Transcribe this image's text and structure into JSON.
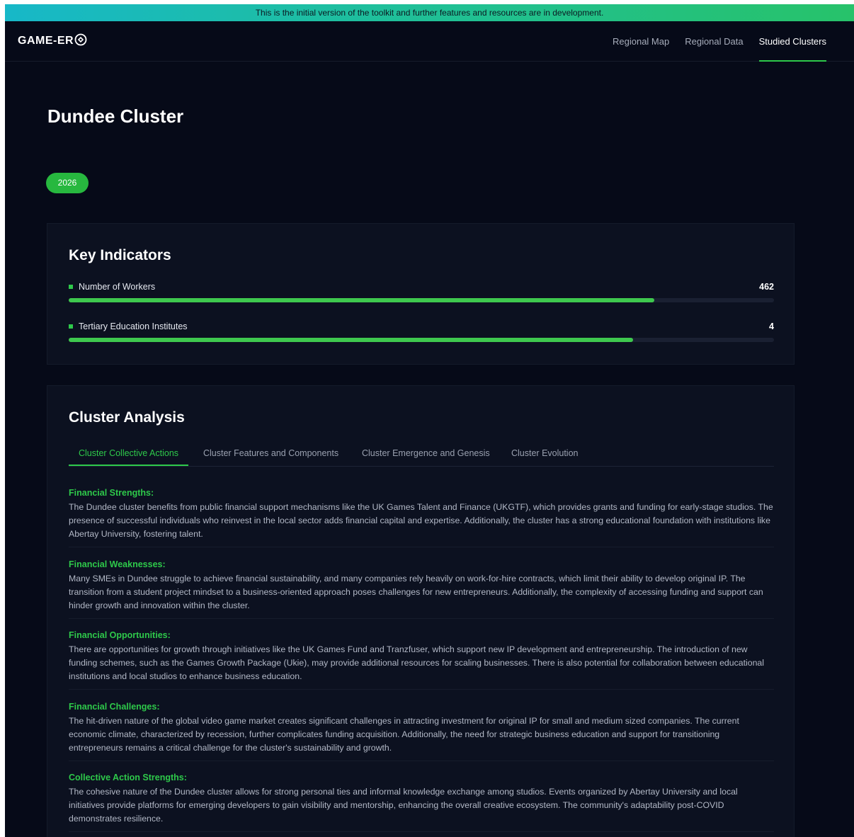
{
  "banner": {
    "text": "This is the initial version of the toolkit and further features and resources are in development."
  },
  "header": {
    "logo_text": "GAME-ER",
    "nav": [
      {
        "label": "Regional Map"
      },
      {
        "label": "Regional Data"
      },
      {
        "label": "Studied Clusters",
        "active": true
      }
    ]
  },
  "page": {
    "title": "Dundee Cluster",
    "year": "2026"
  },
  "key_indicators": {
    "title": "Key Indicators",
    "items": [
      {
        "label": "Number of Workers",
        "value": "462",
        "fill_fraction": 0.83
      },
      {
        "label": "Tertiary Education Institutes",
        "value": "4",
        "fill_fraction": 0.8
      }
    ]
  },
  "cluster_analysis": {
    "title": "Cluster Analysis",
    "tabs": [
      {
        "label": "Cluster Collective Actions",
        "active": true
      },
      {
        "label": "Cluster Features and Components"
      },
      {
        "label": "Cluster Emergence and Genesis"
      },
      {
        "label": "Cluster Evolution"
      }
    ],
    "sections": [
      {
        "heading": "Financial Strengths:",
        "body": "The Dundee cluster benefits from public financial support mechanisms like the UK Games Talent and Finance (UKGTF), which provides grants and funding for early-stage studios. The presence of successful individuals who reinvest in the local sector adds financial capital and expertise. Additionally, the cluster has a strong educational foundation with institutions like Abertay University, fostering talent."
      },
      {
        "heading": "Financial Weaknesses:",
        "body": "Many SMEs in Dundee struggle to achieve financial sustainability, and many companies rely heavily on work-for-hire contracts, which limit their ability to develop original IP. The transition from a student project mindset to a business-oriented approach poses challenges for new entrepreneurs. Additionally, the complexity of accessing funding and support can hinder growth and innovation within the cluster."
      },
      {
        "heading": "Financial Opportunities:",
        "body": "There are opportunities for growth through initiatives like the UK Games Fund and Tranzfuser, which support new IP development and entrepreneurship. The introduction of new funding schemes, such as the Games Growth Package (Ukie), may provide additional resources for scaling businesses. There is also potential for collaboration between educational institutions and local studios to enhance business education."
      },
      {
        "heading": "Financial Challenges:",
        "body": "The hit-driven nature of the global video game market creates significant challenges in attracting investment for original IP for small and medium sized companies. The current economic climate, characterized by recession, further complicates funding acquisition. Additionally, the need for strategic business education and support for transitioning entrepreneurs remains a critical challenge for the cluster's sustainability and growth."
      },
      {
        "heading": "Collective Action Strengths:",
        "body": "The cohesive nature of the Dundee cluster allows for strong personal ties and informal knowledge exchange among studios. Events organized by Abertay University and local initiatives provide platforms for emerging developers to gain visibility and mentorship, enhancing the overall creative ecosystem. The community's adaptability post-COVID demonstrates resilience."
      }
    ]
  }
}
